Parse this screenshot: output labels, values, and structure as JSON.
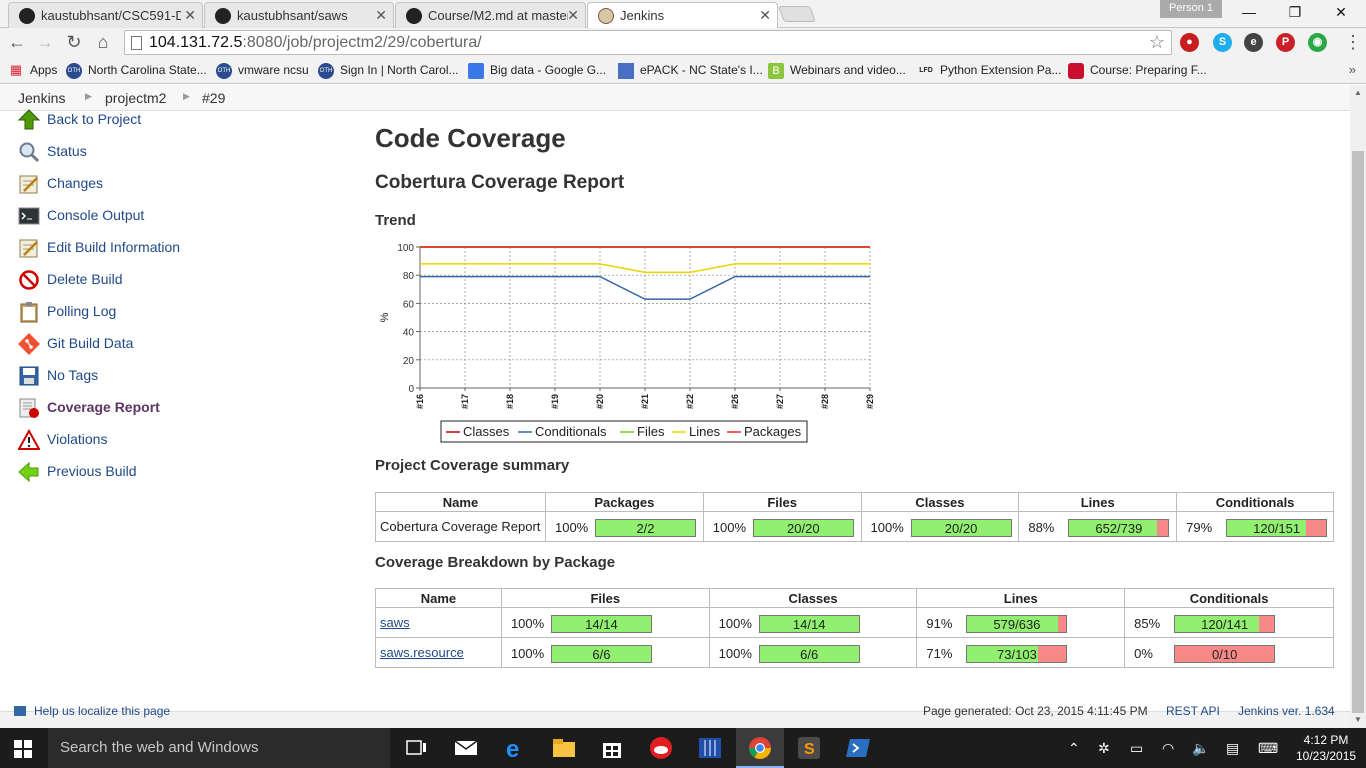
{
  "browser": {
    "tabs": [
      {
        "label": "kaustubhsant/CSC591-De",
        "active": false
      },
      {
        "label": "kaustubhsant/saws",
        "active": false
      },
      {
        "label": "Course/M2.md at master",
        "active": false
      },
      {
        "label": "Jenkins",
        "active": true
      }
    ],
    "profile": "Person 1",
    "url_host": "104.131.72.5",
    "url_rest": ":8080/job/projectm2/29/cobertura/",
    "bookmarks": [
      {
        "label": "Apps",
        "icon": "apps-grid-icon"
      },
      {
        "label": "North Carolina State...",
        "icon": "oth-icon"
      },
      {
        "label": "vmware ncsu",
        "icon": "oth-icon"
      },
      {
        "label": "Sign In | North Carol...",
        "icon": "oth-icon"
      },
      {
        "label": "Big data - Google G...",
        "icon": "google-groups-icon"
      },
      {
        "label": "ePACK - NC State's I...",
        "icon": "epack-icon"
      },
      {
        "label": "Webinars and video...",
        "icon": "b-icon"
      },
      {
        "label": "Python Extension Pa...",
        "icon": "lfd-icon"
      },
      {
        "label": "Course: Preparing F...",
        "icon": "course-icon"
      }
    ],
    "bookmark_text": {
      "oth": "OTH",
      "lfd": "LFD",
      "b": "B"
    }
  },
  "breadcrumb": [
    "Jenkins",
    "projectm2",
    "#29"
  ],
  "sidebar": {
    "items": [
      {
        "label": "Back to Project",
        "icon": "up-arrow-icon"
      },
      {
        "label": "Status",
        "icon": "magnifier-icon"
      },
      {
        "label": "Changes",
        "icon": "notepad-icon"
      },
      {
        "label": "Console Output",
        "icon": "terminal-icon"
      },
      {
        "label": "Edit Build Information",
        "icon": "notepad-icon"
      },
      {
        "label": "Delete Build",
        "icon": "no-entry-icon"
      },
      {
        "label": "Polling Log",
        "icon": "clipboard-icon"
      },
      {
        "label": "Git Build Data",
        "icon": "git-icon"
      },
      {
        "label": "No Tags",
        "icon": "floppy-icon"
      },
      {
        "label": "Coverage Report",
        "icon": "coverage-icon"
      },
      {
        "label": "Violations",
        "icon": "warning-icon"
      },
      {
        "label": "Previous Build",
        "icon": "left-arrow-icon"
      }
    ]
  },
  "main": {
    "title": "Code Coverage",
    "subtitle": "Cobertura Coverage Report",
    "trend_heading": "Trend",
    "summary_heading": "Project Coverage summary",
    "breakdown_heading": "Coverage Breakdown by Package"
  },
  "chart_data": {
    "type": "line",
    "x": [
      "#16",
      "#17",
      "#18",
      "#19",
      "#20",
      "#21",
      "#22",
      "#26",
      "#27",
      "#28",
      "#29"
    ],
    "ylabel": "%",
    "ylim": [
      0,
      100
    ],
    "yticks": [
      0,
      20,
      40,
      60,
      80,
      100
    ],
    "grid": true,
    "legend_position": "bottom",
    "series": [
      {
        "name": "Classes",
        "color": "#cc0000",
        "values": [
          100,
          100,
          100,
          100,
          100,
          100,
          100,
          100,
          100,
          100,
          100
        ]
      },
      {
        "name": "Conditionals",
        "color": "#3465a4",
        "values": [
          79,
          79,
          79,
          79,
          79,
          63,
          63,
          79,
          79,
          79,
          79
        ]
      },
      {
        "name": "Files",
        "color": "#73d216",
        "values": [
          100,
          100,
          100,
          100,
          100,
          100,
          100,
          100,
          100,
          100,
          100
        ]
      },
      {
        "name": "Lines",
        "color": "#edd400",
        "values": [
          88,
          88,
          88,
          88,
          88,
          82,
          82,
          88,
          88,
          88,
          88
        ]
      },
      {
        "name": "Packages",
        "color": "#ef2929",
        "values": [
          100,
          100,
          100,
          100,
          100,
          100,
          100,
          100,
          100,
          100,
          100
        ]
      }
    ]
  },
  "summary_table": {
    "headers": [
      "Name",
      "Packages",
      "Files",
      "Classes",
      "Lines",
      "Conditionals"
    ],
    "rows": [
      {
        "name": "Cobertura Coverage Report",
        "cells": [
          {
            "pct": "100%",
            "ratio": "2/2",
            "fraction": 1.0
          },
          {
            "pct": "100%",
            "ratio": "20/20",
            "fraction": 1.0
          },
          {
            "pct": "100%",
            "ratio": "20/20",
            "fraction": 1.0
          },
          {
            "pct": "88%",
            "ratio": "652/739",
            "fraction": 0.882
          },
          {
            "pct": "79%",
            "ratio": "120/151",
            "fraction": 0.795
          }
        ]
      }
    ]
  },
  "breakdown_table": {
    "headers": [
      "Name",
      "Files",
      "Classes",
      "Lines",
      "Conditionals"
    ],
    "rows": [
      {
        "name": "saws",
        "cells": [
          {
            "pct": "100%",
            "ratio": "14/14",
            "fraction": 1.0
          },
          {
            "pct": "100%",
            "ratio": "14/14",
            "fraction": 1.0
          },
          {
            "pct": "91%",
            "ratio": "579/636",
            "fraction": 0.91
          },
          {
            "pct": "85%",
            "ratio": "120/141",
            "fraction": 0.851
          }
        ]
      },
      {
        "name": "saws.resource",
        "cells": [
          {
            "pct": "100%",
            "ratio": "6/6",
            "fraction": 1.0
          },
          {
            "pct": "100%",
            "ratio": "6/6",
            "fraction": 1.0
          },
          {
            "pct": "71%",
            "ratio": "73/103",
            "fraction": 0.709
          },
          {
            "pct": "0%",
            "ratio": "0/10",
            "fraction": 0.0
          }
        ]
      }
    ]
  },
  "footer": {
    "localize": "Help us localize this page",
    "generated": "Page generated: Oct 23, 2015 4:11:45 PM",
    "rest_api": "REST API",
    "version": "Jenkins ver. 1.634"
  },
  "taskbar": {
    "search_placeholder": "Search the web and Windows",
    "time": "4:12 PM",
    "date": "10/23/2015"
  }
}
